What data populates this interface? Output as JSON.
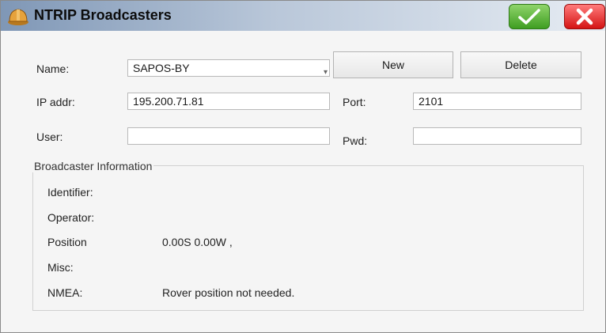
{
  "window": {
    "title": "NTRIP Broadcasters",
    "app_icon": "hardhat-icon",
    "ok_icon": "checkmark-icon",
    "close_icon": "close-x-icon",
    "ok_color": "#3f9e22",
    "close_color": "#d41414"
  },
  "form": {
    "name_label": "Name:",
    "name_value": "SAPOS-BY",
    "new_label": "New",
    "delete_label": "Delete",
    "ip_label": "IP addr:",
    "ip_value": "195.200.71.81",
    "port_label": "Port:",
    "port_value": "2101",
    "user_label": "User:",
    "user_value": "",
    "pwd_label": "Pwd:",
    "pwd_value": ""
  },
  "info": {
    "group_title": "Broadcaster Information",
    "identifier_label": "Identifier:",
    "identifier_value": "",
    "operator_label": "Operator:",
    "operator_value": "",
    "position_label": "Position",
    "position_value": "0.00S 0.00W ,",
    "misc_label": "Misc:",
    "misc_value": "",
    "nmea_label": "NMEA:",
    "nmea_value": "Rover position not needed."
  }
}
